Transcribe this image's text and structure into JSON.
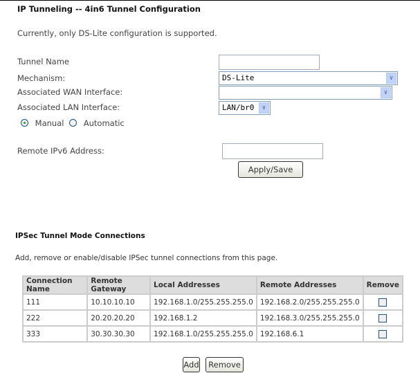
{
  "page": {
    "title": "IP Tunneling -- 4in6 Tunnel Configuration",
    "note": "Currently, only DS-Lite configuration is supported."
  },
  "form": {
    "tunnel_name_label": "Tunnel Name",
    "tunnel_name_value": "",
    "mechanism_label": "Mechanism:",
    "mechanism_value": "DS-Lite",
    "wan_label": "Associated WAN Interface:",
    "wan_value": "",
    "lan_label": "Associated LAN Interface:",
    "lan_value": "LAN/br0",
    "radio_manual": "Manual",
    "radio_automatic": "Automatic",
    "selected_mode": "Manual",
    "remote_ipv6_label": "Remote IPv6 Address:",
    "remote_ipv6_value": "",
    "apply_label": "Apply/Save"
  },
  "ipsec": {
    "title": "IPSec Tunnel Mode Connections",
    "description": "Add, remove or enable/disable IPSec tunnel connections from this page.",
    "columns": [
      "Connection Name",
      "Remote Gateway",
      "Local Addresses",
      "Remote Addresses",
      "Remove"
    ],
    "rows": [
      [
        "111",
        "10.10.10.10",
        "192.168.1.0/255.255.255.0",
        "192.168.2.0/255.255.255.0"
      ],
      [
        "222",
        "20.20.20.20",
        "192.168.1.2",
        "192.168.3.0/255.255.255.0"
      ],
      [
        "333",
        "30.30.30.30",
        "192.168.1.0/255.255.255.0",
        "192.168.6.1"
      ]
    ],
    "add_label": "Add",
    "remove_label": "Remove"
  }
}
